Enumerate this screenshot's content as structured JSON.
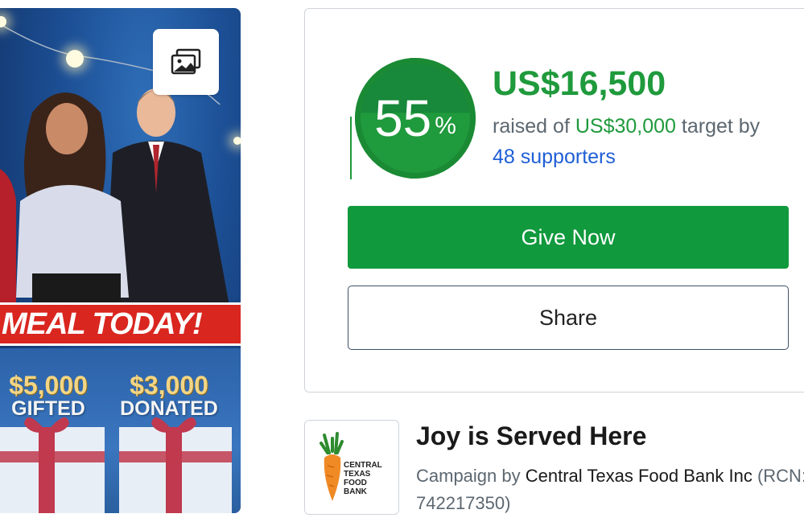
{
  "promo": {
    "banner_text": "MEAL TODAY!",
    "stats": [
      {
        "amount": "$5,000",
        "label": "GIFTED"
      },
      {
        "amount": "$3,000",
        "label": "DONATED"
      }
    ],
    "gallery_icon": "image-gallery-icon"
  },
  "progress": {
    "percent": 55,
    "percent_number": "55",
    "percent_symbol": "%",
    "raised": "US$16,500",
    "raised_prefix": "raised of ",
    "target": "US$30,000",
    "target_suffix": " target by",
    "supporters": "48 supporters"
  },
  "actions": {
    "give_label": "Give Now",
    "share_label": "Share"
  },
  "campaign": {
    "title": "Joy is Served Here",
    "by_prefix": "Campaign by ",
    "org": "Central Texas Food Bank Inc",
    "reg": " (RCN: 742217350)",
    "logo_lines": [
      "CENTRAL",
      "TEXAS",
      "FOOD",
      "BANK"
    ]
  },
  "colors": {
    "accent_green": "#10993d",
    "link_blue": "#1f5fd6",
    "banner_red": "#d9261f"
  }
}
